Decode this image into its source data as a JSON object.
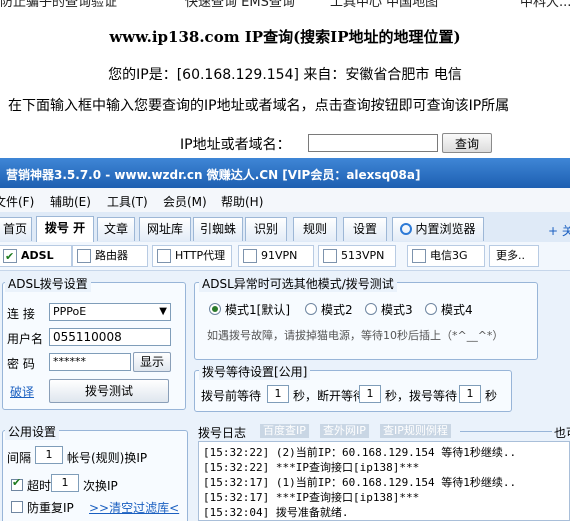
{
  "web": {
    "top_cut": [
      "防止骗子的查询验证",
      "快速查询 EMS查询",
      "工具中心 中国地图",
      "中科大..."
    ],
    "site_title": "www.ip138.com IP查询(搜索IP地址的地理位置)",
    "ip_line": "您的IP是：[60.168.129.154] 来自：安徽省合肥市 电信",
    "hint": "在下面输入框中输入您要查询的IP地址或者域名，点击查询按钮即可查询该IP所属",
    "query_label": "IP地址或者域名：",
    "query_value": "",
    "query_button": "查询"
  },
  "app": {
    "title": "营销神器3.5.7.0 - www.wzdr.cn 微赚达人.CN [VIP会员：alexsq08a]",
    "menu": [
      "文件(F)",
      "辅助(E)",
      "工具(T)",
      "会员(M)",
      "帮助(H)"
    ],
    "tabs": [
      "首页",
      "拨号 开",
      "文章",
      "网址库",
      "引蜘蛛",
      "识别",
      "规则",
      "设置",
      "内置浏览器"
    ],
    "tab_add": "+ 关",
    "subtabs": [
      {
        "label": "ADSL",
        "checked": true
      },
      {
        "label": "路由器",
        "checked": false
      },
      {
        "label": "HTTP代理",
        "checked": false
      },
      {
        "label": "91VPN",
        "checked": false
      },
      {
        "label": "513VPN",
        "checked": false
      },
      {
        "label": "电信3G",
        "checked": false
      },
      {
        "label": "更多..",
        "checked": false
      }
    ],
    "adsl": {
      "legend": "ADSL拨号设置",
      "conn_label": "连 接",
      "conn_value": "PPPoE",
      "user_label": "用户名",
      "user_value": "055110008",
      "pwd_label": "密 码",
      "pwd_value": "******",
      "show_btn": "显示",
      "link": "破译",
      "test_btn": "拨号测试"
    },
    "mode": {
      "legend": "ADSL异常时可选其他模式/拨号测试",
      "options": [
        "模式1[默认]",
        "模式2",
        "模式3",
        "模式4"
      ],
      "selected": 0,
      "note": "如遇拨号故障，请拔掉猫电源，等待10秒后插上（*^__^*）"
    },
    "wait": {
      "legend": "拨号等待设置[公用]",
      "before": "拨号前等待",
      "before_val": "1",
      "sec1": "秒，断开等待",
      "disc_val": "1",
      "sec2": "秒，拨号等待",
      "dial_val": "1",
      "sec3": "秒"
    },
    "common": {
      "legend": "公用设置",
      "interval": "间隔",
      "interval_val": "1",
      "interval_tail": "帐号(规则)换IP",
      "timeout_label": "超时",
      "timeout_val": "1",
      "timeout_tail": "次换IP",
      "timeout_checked": true,
      "repeat_label": "防重复IP",
      "repeat_checked": false,
      "filter_link": ">>清空过滤库<"
    },
    "log": {
      "legend": "拨号日志",
      "tabs": [
        "百度查IP",
        "查外网IP",
        "查IP规则例程"
      ],
      "tail": "也可",
      "lines": [
        "[15:32:22] (2)当前IP：60.168.129.154 等待1秒继续..",
        "[15:32:22] ***IP查询接口[ip138]***",
        "[15:32:17] (1)当前IP：60.168.129.154 等待1秒继续..",
        "[15:32:17] ***IP查询接口[ip138]***",
        "[15:32:04] 拨号准备就绪."
      ]
    }
  }
}
